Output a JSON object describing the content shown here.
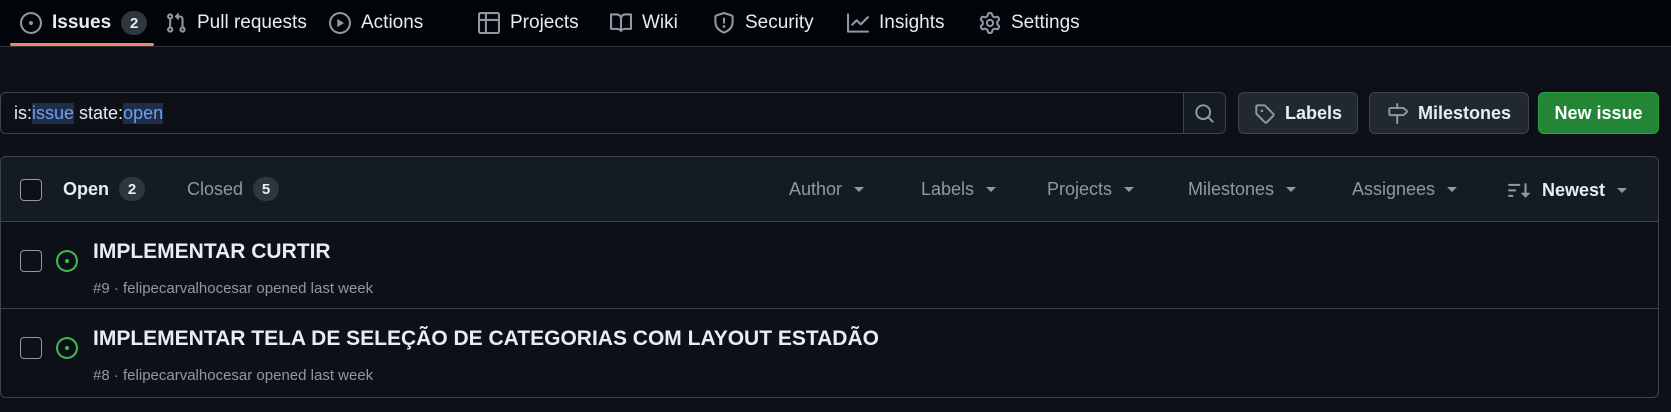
{
  "repo_nav": {
    "tabs": [
      {
        "label": "Issues",
        "count": "2"
      },
      {
        "label": "Pull requests"
      },
      {
        "label": "Actions"
      },
      {
        "label": "Projects"
      },
      {
        "label": "Wiki"
      },
      {
        "label": "Security"
      },
      {
        "label": "Insights"
      },
      {
        "label": "Settings"
      }
    ],
    "selected": "Issues",
    "accent_color": "#f78166"
  },
  "search": {
    "query_parts": [
      "is:",
      "issue",
      " state:",
      "open"
    ]
  },
  "toolbar": {
    "labels_button": "Labels",
    "milestones_button": "Milestones",
    "new_issue_button": "New issue",
    "new_issue_color": "#238636"
  },
  "issues_header": {
    "open_label": "Open",
    "open_count": "2",
    "closed_label": "Closed",
    "closed_count": "5",
    "filters": [
      "Author",
      "Labels",
      "Projects",
      "Milestones",
      "Assignees"
    ],
    "sort_label": "Newest"
  },
  "issues": [
    {
      "title": "IMPLEMENTAR CURTIR",
      "meta": "#9 · felipecarvalhocesar opened last week",
      "state_color": "#3fb950"
    },
    {
      "title": "IMPLEMENTAR TELA DE SELEÇÃO DE CATEGORIAS COM LAYOUT ESTADÃO",
      "meta": "#8 · felipecarvalhocesar opened last week",
      "state_color": "#3fb950"
    }
  ]
}
